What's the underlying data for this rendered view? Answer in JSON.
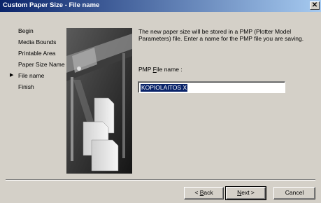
{
  "window": {
    "title": "Custom Paper Size - File name",
    "close_glyph": "✕"
  },
  "steps": [
    {
      "label": "Begin"
    },
    {
      "label": "Media Bounds"
    },
    {
      "label": "Printable Area"
    },
    {
      "label": "Paper Size Name"
    },
    {
      "label": "File name",
      "current": true
    },
    {
      "label": "Finish"
    }
  ],
  "current_step_marker": "▶",
  "description": "The new paper size will be stored in a PMP (Plotter Model Parameters) file. Enter a name for the PMP file you are saving.",
  "field": {
    "label_before": "PMP ",
    "label_mnemonic": "F",
    "label_after": "ile name :",
    "value": "KOPIOLAITOS X"
  },
  "buttons": {
    "back": {
      "pre": "< ",
      "mnemonic": "B",
      "post": "ack"
    },
    "next": {
      "pre": "",
      "mnemonic": "N",
      "post": "ext >"
    },
    "cancel": "Cancel"
  },
  "icons": {
    "illustration": "plotter-illustration",
    "close": "close-icon",
    "marker": "current-step-arrow-icon"
  }
}
